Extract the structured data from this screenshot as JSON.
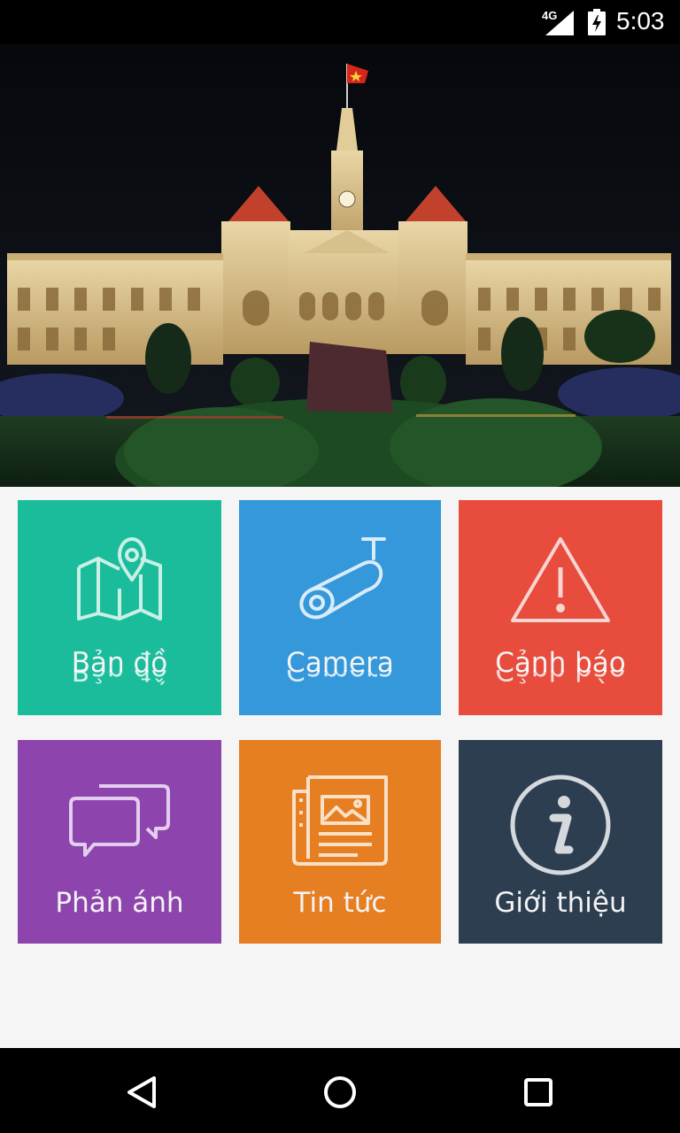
{
  "status_bar": {
    "network": "4G",
    "time": "5:03"
  },
  "hero": {
    "image": "Ho Chi Minh City Hall at night"
  },
  "tiles": [
    {
      "label": "Bản đồ",
      "icon": "map-pin-icon",
      "color": "#1abc9c"
    },
    {
      "label": "Camera",
      "icon": "camera-icon",
      "color": "#3498db"
    },
    {
      "label": "Cảnh báo",
      "icon": "warning-icon",
      "color": "#e74c3c"
    },
    {
      "label": "Phản ánh",
      "icon": "chat-bubbles-icon",
      "color": "#8e44ad"
    },
    {
      "label": "Tin tức",
      "icon": "newspaper-icon",
      "color": "#e67e22"
    },
    {
      "label": "Giới thiệu",
      "icon": "info-icon",
      "color": "#2c3e50"
    }
  ],
  "nav": {
    "back": "back-icon",
    "home": "home-icon",
    "recents": "recents-icon"
  }
}
